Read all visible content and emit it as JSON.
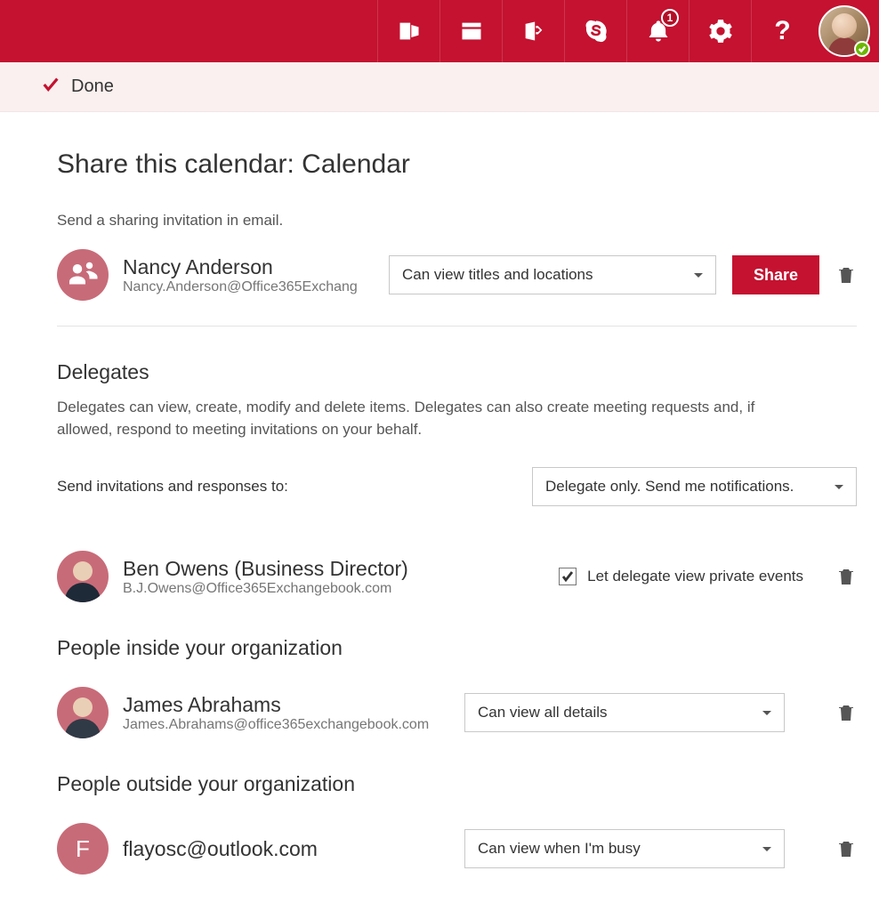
{
  "topbar": {
    "notification_count": "1"
  },
  "donebar": {
    "label": "Done"
  },
  "page": {
    "title": "Share this calendar: Calendar",
    "invite_subtext": "Send a sharing invitation in email."
  },
  "invite": {
    "name": "Nancy Anderson",
    "email": "Nancy.Anderson@Office365Exchang",
    "permission": "Can view titles and locations",
    "share_label": "Share"
  },
  "delegates": {
    "heading": "Delegates",
    "desc": "Delegates can view, create, modify and delete items. Delegates can also create meeting requests and, if allowed, respond to meeting invitations on your behalf.",
    "send_to_label": "Send invitations and responses to:",
    "send_to_value": "Delegate only. Send me notifications.",
    "private_label": "Let delegate view private events",
    "person": {
      "name": "Ben Owens (Business Director)",
      "email": "B.J.Owens@Office365Exchangebook.com"
    }
  },
  "inside": {
    "heading": "People inside your organization",
    "person": {
      "name": "James Abrahams",
      "email": "James.Abrahams@office365exchangebook.com"
    },
    "permission": "Can view all details"
  },
  "outside": {
    "heading": "People outside your organization",
    "person": {
      "initial": "F",
      "email": "flayosc@outlook.com"
    },
    "permission": "Can view when I'm busy"
  }
}
